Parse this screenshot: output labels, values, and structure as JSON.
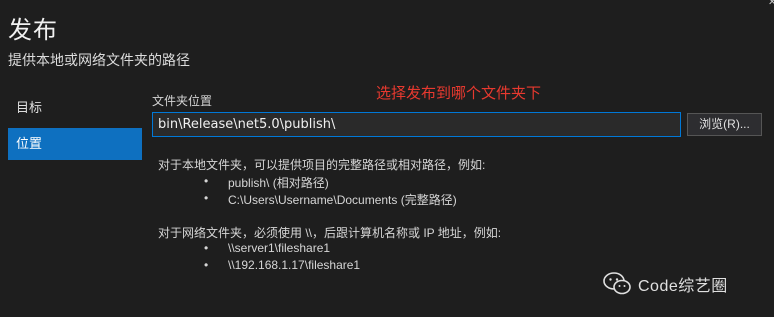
{
  "header": {
    "title": "发布",
    "subtitle": "提供本地或网络文件夹的路径"
  },
  "sidebar": {
    "items": [
      {
        "label": "目标",
        "selected": false
      },
      {
        "label": "位置",
        "selected": true
      }
    ]
  },
  "main": {
    "folder_label": "文件夹位置",
    "annotation": "选择发布到哪个文件夹下",
    "path_value": "bin\\Release\\net5.0\\publish\\",
    "browse_label": "浏览(R)...",
    "local_intro": "对于本地文件夹，可以提供项目的完整路径或相对路径，例如:",
    "local_examples": [
      "publish\\ (相对路径)",
      "C:\\Users\\Username\\Documents (完整路径)"
    ],
    "network_intro": "对于网络文件夹，必须使用 \\\\，后跟计算机名称或 IP 地址，例如:",
    "network_examples": [
      "\\\\server1\\fileshare1",
      "\\\\192.168.1.17\\fileshare1"
    ],
    "bullet_char": "•"
  },
  "watermark": {
    "icon": "wechat-icon",
    "text": "Code综艺圈"
  },
  "colors": {
    "background": "#1e1e1e",
    "accent": "#0e70c0",
    "annotation": "#e8392f"
  }
}
